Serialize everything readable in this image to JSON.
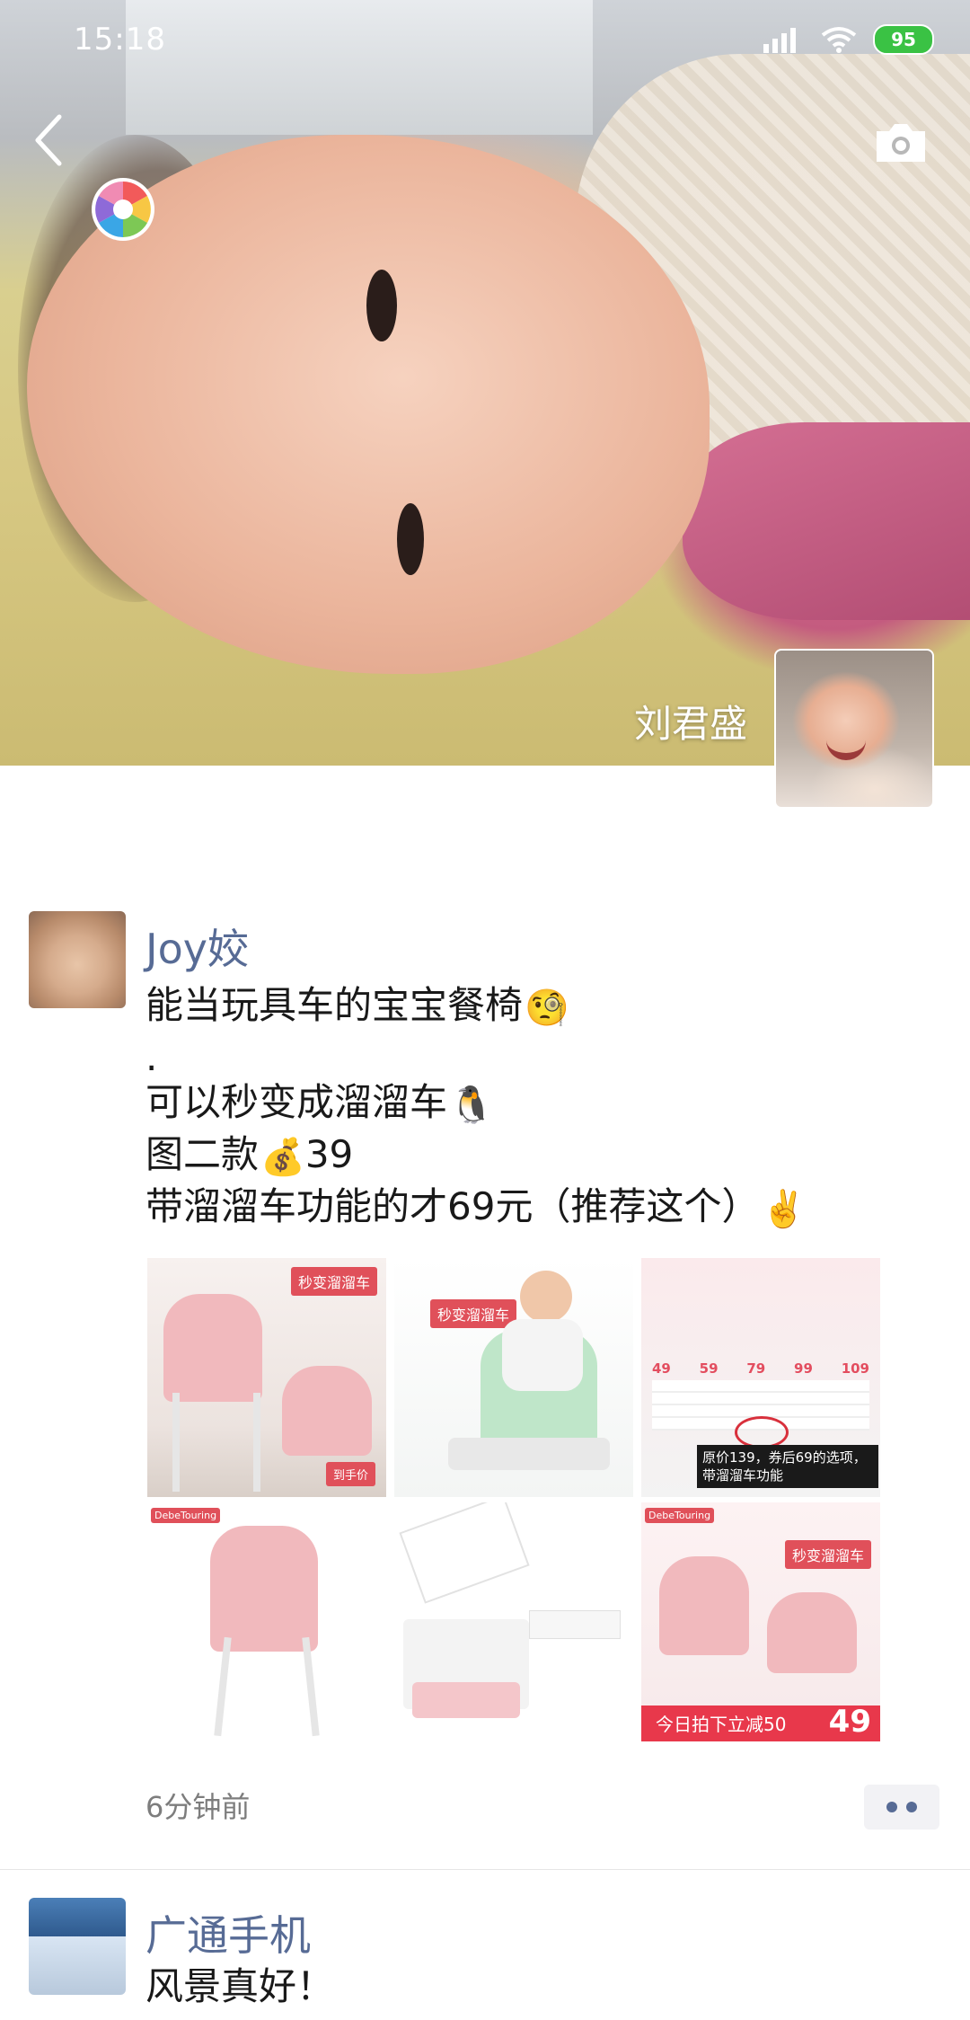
{
  "status_bar": {
    "time": "15:18",
    "battery": "95",
    "icons": [
      "signal-icon",
      "wifi-icon",
      "battery-icon"
    ]
  },
  "header": {
    "cover_name": "刘君盛",
    "icons": [
      "back-icon",
      "camera-icon",
      "shutter-icon"
    ]
  },
  "posts": [
    {
      "author": "Joy姣",
      "lines": [
        {
          "text": "能当玩具车的宝宝餐椅",
          "emoji": "🧐"
        },
        {
          "text": ".",
          "emoji": ""
        },
        {
          "text": "可以秒变成溜溜车",
          "emoji": "🐧"
        },
        {
          "text": "图二款",
          "emoji": "💰",
          "suffix": "39"
        },
        {
          "text": "带溜溜车功能的才69元（推荐这个）",
          "emoji": "✌️"
        }
      ],
      "photos": [
        {
          "label": "秒变溜溜车",
          "corner": "到手价"
        },
        {
          "label": "秒变溜溜车"
        },
        {
          "prices": [
            "49",
            "59",
            "79",
            "99",
            "109"
          ],
          "caption": "原价139，券后69的选项，带溜溜车功能"
        },
        {
          "brand": "DebeTouring"
        },
        {},
        {
          "brand": "DebeTouring",
          "banner": "秒变溜溜车",
          "bottom": "今日拍下立减50",
          "price": "49"
        }
      ],
      "time": "6分钟前"
    },
    {
      "author": "广通手机",
      "lines": [
        {
          "text": "风景真好！"
        }
      ]
    }
  ],
  "colors": {
    "link": "#576b95",
    "text": "#191919",
    "meta": "#7d7d7d"
  }
}
